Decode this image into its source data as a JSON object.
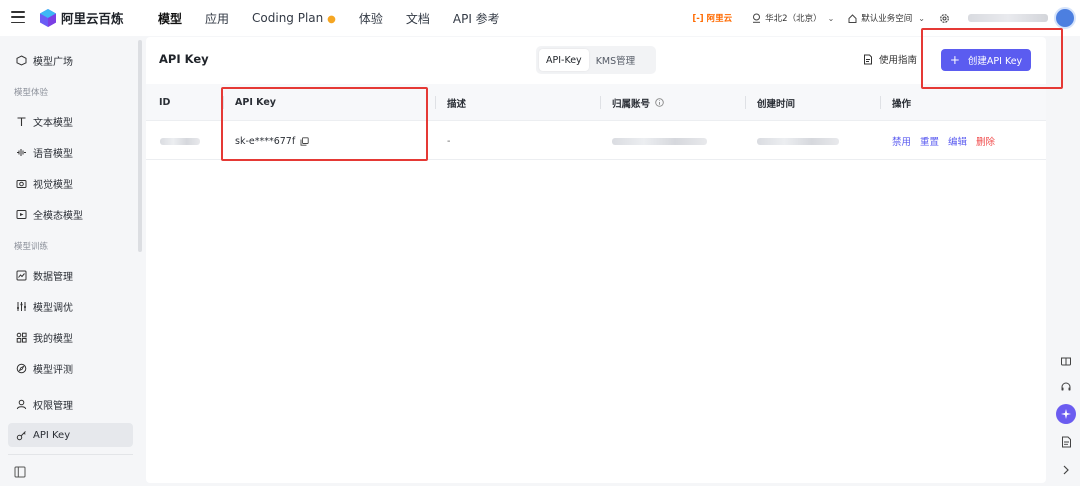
{
  "brand": {
    "name": "阿里云百炼"
  },
  "nav": {
    "items": [
      "模型",
      "应用",
      "Coding Plan",
      "体验",
      "文档",
      "API 参考"
    ],
    "active_index": 0
  },
  "topbar": {
    "aliyun_logo_text": "[-] 阿里云",
    "region": "华北2（北京）",
    "workspace": "默认业务空间"
  },
  "sidebar": {
    "top_item": "模型广场",
    "section_experience": "模型体验",
    "experience_items": [
      "文本模型",
      "语音模型",
      "视觉模型",
      "全模态模型"
    ],
    "section_training": "模型训练",
    "training_items": [
      "数据管理",
      "模型调优",
      "我的模型",
      "模型评测"
    ],
    "permission_item": "权限管理",
    "apikey_item": "API Key"
  },
  "panel": {
    "title": "API Key",
    "tabs": [
      "API-Key",
      "KMS管理"
    ],
    "active_tab": 0,
    "guide_label": "使用指南",
    "create_label": "创建API Key",
    "table": {
      "headers": [
        "ID",
        "API Key",
        "描述",
        "归属账号",
        "创建时间",
        "操作"
      ],
      "row": {
        "api_key": "sk-e****677f",
        "description": "-",
        "actions": [
          "禁用",
          "重置",
          "编辑",
          "删除"
        ]
      }
    }
  },
  "colors": {
    "accent": "#5b5cf0",
    "danger": "#f04a4a",
    "annotation": "#e53935",
    "aliyun_orange": "#ff6a00"
  }
}
